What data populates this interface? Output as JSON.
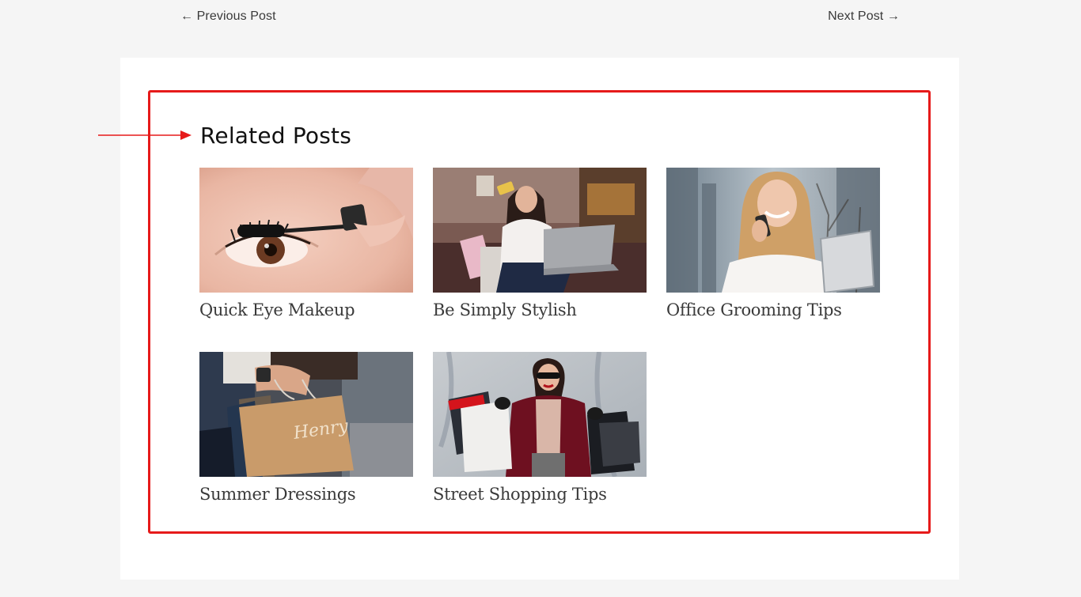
{
  "navigation": {
    "previous_label": "← Previous Post",
    "next_label": "Next Post →"
  },
  "related": {
    "heading": "Related Posts",
    "posts": [
      {
        "title": "Quick Eye Makeup",
        "image": "mascara-eye-photo"
      },
      {
        "title": "Be Simply Stylish",
        "image": "woman-laptop-shopping-photo"
      },
      {
        "title": "Office Grooming Tips",
        "image": "woman-phone-tablet-photo"
      },
      {
        "title": "Summer Dressings",
        "image": "shopping-bag-hands-photo"
      },
      {
        "title": "Street Shopping Tips",
        "image": "woman-shopping-bags-photo"
      }
    ]
  },
  "colors": {
    "highlight": "#e61a1a",
    "card_background": "#ffffff",
    "page_background": "#f5f5f5",
    "title_text": "#3a3a3a"
  }
}
